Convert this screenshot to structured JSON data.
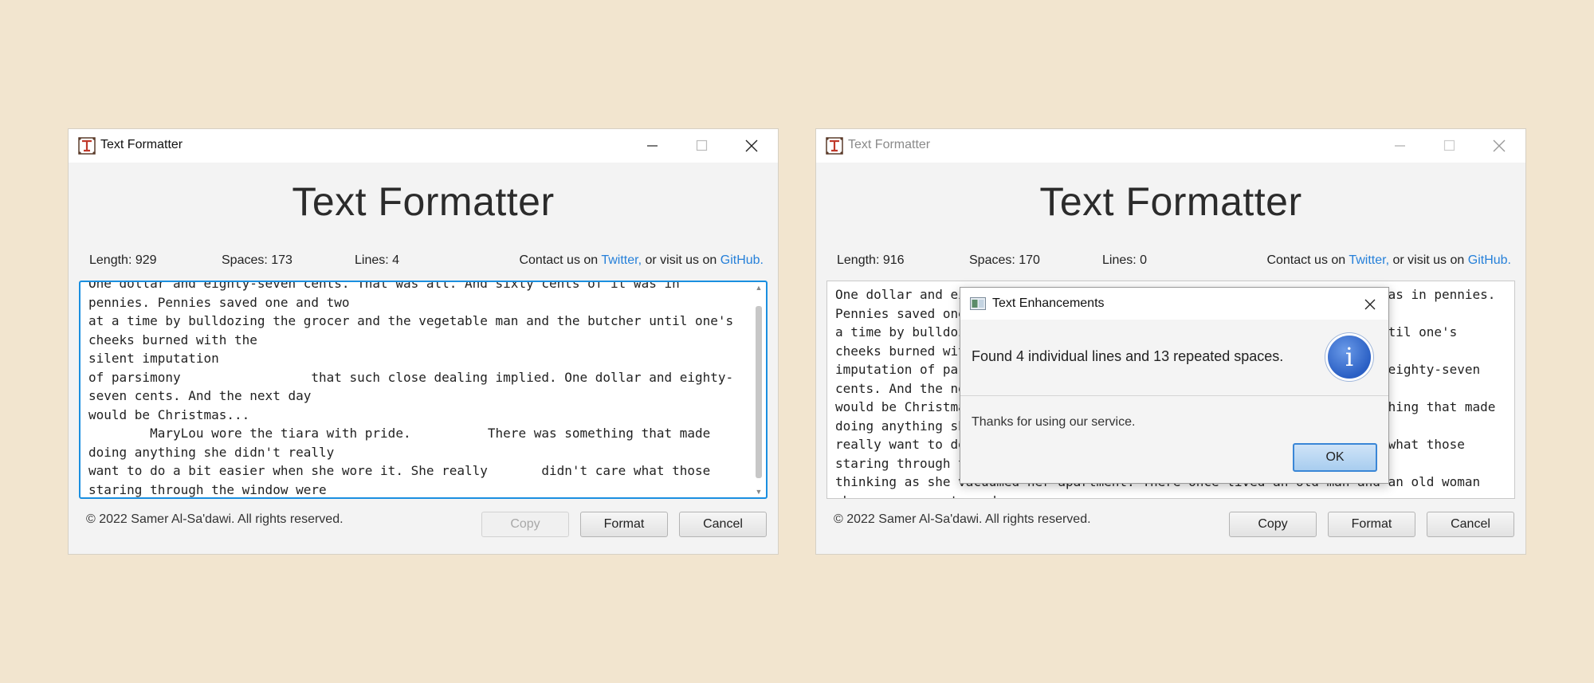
{
  "left_window": {
    "title": "Text Formatter",
    "heading": "Text Formatter",
    "stats": {
      "length": "Length: 929",
      "spaces": "Spaces: 173",
      "lines": "Lines: 4"
    },
    "contact": {
      "prefix": "Contact us on",
      "twitter": "Twitter,",
      "middle": "or visit us on",
      "github": "GitHub."
    },
    "text": "One dollar and eighty-seven cents. That was all. And sixty cents of it was in pennies. Pennies saved one and two\nat a time by bulldozing the grocer and the vegetable man and the butcher until one's cheeks burned with the\nsilent imputation\nof parsimony                 that such close dealing implied. One dollar and eighty-seven cents. And the next day\nwould be Christmas...\n        MaryLou wore the tiara with pride.          There was something that made doing anything she didn't really\nwant to do a bit easier when she wore it. She really       didn't care what those staring through the window were\nthinking as she vacuumed her apartment.\nThere once lived an old man and an old woman\nwho were peasants and had to work hard to earn their daily bread. The old man used to go to fix fences and do\nother odd jobs for the farmers around, and while he was gone the old woman, his wife, did the work of the\nhouse and worked in their own little plot of land.",
    "copyright": "© 2022 Samer Al-Sa'dawi. All rights reserved.",
    "buttons": {
      "copy": "Copy",
      "format": "Format",
      "cancel": "Cancel"
    }
  },
  "right_window": {
    "title": "Text Formatter",
    "heading": "Text Formatter",
    "stats": {
      "length": "Length: 916",
      "spaces": "Spaces: 170",
      "lines": "Lines: 0"
    },
    "contact": {
      "prefix": "Contact us on",
      "twitter": "Twitter,",
      "middle": "or visit us on",
      "github": "GitHub."
    },
    "text": "One dollar and eighty-seven cents. That was all. And sixty cents of it was in pennies. Pennies saved one and two at\na time by bulldozing the grocer and the vegetable man and the butcher until one's cheeks burned with the silent\nimputation of parsimony that such close dealing implied. One dollar and eighty-seven cents. And the next day\nwould be Christmas... MaryLou wore the tiara with pride. There was something that made doing anything she didn't\nreally want to do a bit easier when she wore it. She really didn't care what those staring through the window were\nthinking as she vacuumed her apartment. There once lived an old man and an old woman who were peasants and\nhad to work hard to earn their daily bread. The old man used to go to fix fences and do other odd jobs for the\nfarmers around, and while he was gone the old woman, his wife, did the work of the house and worked in their\nown little plot of land.",
    "copyright": "© 2022 Samer Al-Sa'dawi. All rights reserved.",
    "buttons": {
      "copy": "Copy",
      "format": "Format",
      "cancel": "Cancel"
    }
  },
  "dialog": {
    "title": "Text Enhancements",
    "message": "Found 4 individual lines and 13 repeated spaces.",
    "content": "Thanks for using our service.",
    "ok": "OK",
    "icon": "info-icon"
  },
  "colors": {
    "background": "#f2e5cf",
    "link": "#2680d9",
    "focus": "#1a8fe0"
  }
}
